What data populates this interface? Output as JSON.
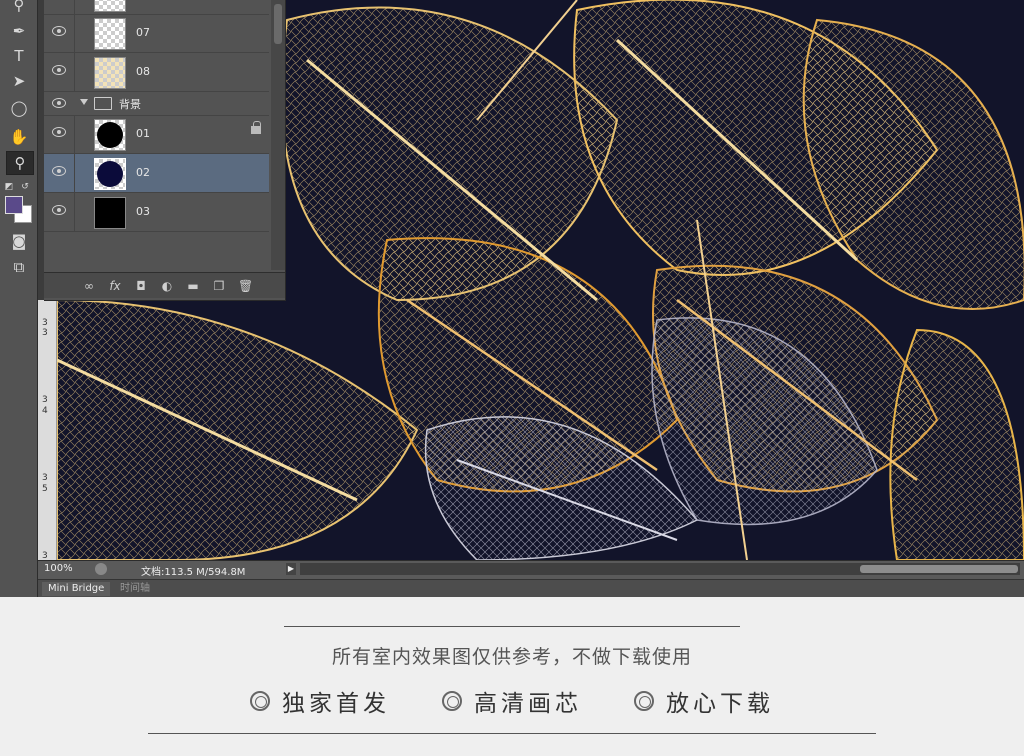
{
  "layers_panel": {
    "layers": [
      {
        "name": "07",
        "thumb": "transparent",
        "row": 0
      },
      {
        "name": "08",
        "thumb": "transparent-beige",
        "row": 1
      }
    ],
    "group": {
      "name": "背景",
      "icon": "folder-icon"
    },
    "group_layers": [
      {
        "name": "01",
        "thumb_color": "#000000",
        "locked": true,
        "selected": false
      },
      {
        "name": "02",
        "thumb_color": "#0b0b3a",
        "locked": false,
        "selected": true
      },
      {
        "name": "03",
        "thumb_color": "#000000",
        "locked": false,
        "selected": false
      }
    ],
    "footer_icons": [
      "link-icon",
      "fx-icon",
      "mask-icon",
      "adjustment-icon",
      "folder-icon",
      "new-layer-icon",
      "trash-icon"
    ],
    "fx_label": "fx"
  },
  "toolbar": {
    "tools": [
      "zoom-icon",
      "pen-icon",
      "type-icon",
      "path-select-icon",
      "ellipse-icon",
      "hand-icon",
      "zoom-icon"
    ],
    "type_glyph": "T",
    "foreground_color": "#5a4a8a",
    "background_color": "#ffffff"
  },
  "ruler": {
    "labels": [
      "3",
      "3",
      "3",
      "4",
      "3",
      "5",
      "3"
    ]
  },
  "status": {
    "zoom": "100%",
    "doc_info": "文档:113.5 M/594.8M"
  },
  "tabs": {
    "mini_bridge": "Mini Bridge",
    "timeline": "时间轴"
  },
  "promo": {
    "notice": "所有室内效果图仅供参考，不做下载使用",
    "features": [
      "独家首发",
      "高清画芯",
      "放心下载"
    ]
  },
  "colors": {
    "canvas_background": "#12142a",
    "leaf_gold": "#e8b54a",
    "leaf_silver": "#c9c9d6"
  }
}
